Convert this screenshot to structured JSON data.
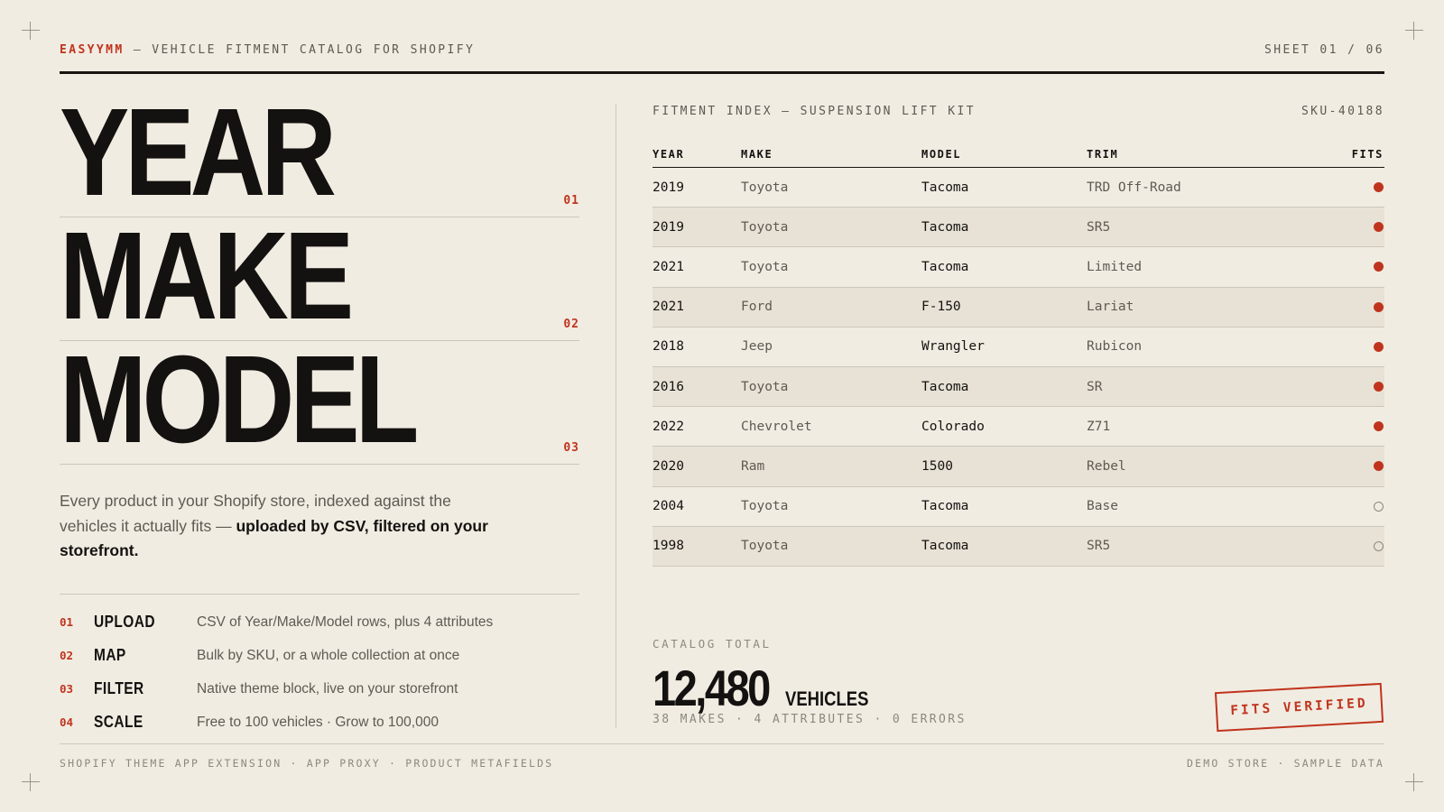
{
  "header": {
    "brand": "EASYYMM",
    "tagline": " — VEHICLE FITMENT CATALOG FOR SHOPIFY",
    "sheet": "SHEET 01 / 06"
  },
  "hero": [
    {
      "word": "YEAR",
      "num": "01"
    },
    {
      "word": "MAKE",
      "num": "02"
    },
    {
      "word": "MODEL",
      "num": "03"
    }
  ],
  "lede": {
    "text": "Every product in your Shopify store, indexed against the vehicles it actually fits — ",
    "emphasis": "uploaded by CSV, filtered on your storefront."
  },
  "steps": [
    {
      "num": "01",
      "title": "UPLOAD",
      "desc": "CSV of Year/Make/Model rows, plus 4 attributes"
    },
    {
      "num": "02",
      "title": "MAP",
      "desc": "Bulk by SKU, or a whole collection at once"
    },
    {
      "num": "03",
      "title": "FILTER",
      "desc": "Native theme block, live on your storefront"
    },
    {
      "num": "04",
      "title": "SCALE",
      "desc": "Free to 100 vehicles · Grow to 100,000"
    }
  ],
  "fitment": {
    "title": "FITMENT INDEX — SUSPENSION LIFT KIT",
    "sku": "SKU-40188",
    "columns": [
      "YEAR",
      "MAKE",
      "MODEL",
      "TRIM",
      "FITS"
    ],
    "rows": [
      {
        "year": "2019",
        "make": "Toyota",
        "model": "Tacoma",
        "trim": "TRD Off-Road",
        "fits": true
      },
      {
        "year": "2019",
        "make": "Toyota",
        "model": "Tacoma",
        "trim": "SR5",
        "fits": true
      },
      {
        "year": "2021",
        "make": "Toyota",
        "model": "Tacoma",
        "trim": "Limited",
        "fits": true
      },
      {
        "year": "2021",
        "make": "Ford",
        "model": "F-150",
        "trim": "Lariat",
        "fits": true
      },
      {
        "year": "2018",
        "make": "Jeep",
        "model": "Wrangler",
        "trim": "Rubicon",
        "fits": true
      },
      {
        "year": "2016",
        "make": "Toyota",
        "model": "Tacoma",
        "trim": "SR",
        "fits": true
      },
      {
        "year": "2022",
        "make": "Chevrolet",
        "model": "Colorado",
        "trim": "Z71",
        "fits": true
      },
      {
        "year": "2020",
        "make": "Ram",
        "model": "1500",
        "trim": "Rebel",
        "fits": true
      },
      {
        "year": "2004",
        "make": "Toyota",
        "model": "Tacoma",
        "trim": "Base",
        "fits": false
      },
      {
        "year": "1998",
        "make": "Toyota",
        "model": "Tacoma",
        "trim": "SR5",
        "fits": false
      }
    ]
  },
  "catalog": {
    "label": "CATALOG TOTAL",
    "total": "12,480",
    "unit": "VEHICLES",
    "meta": "38 MAKES · 4 ATTRIBUTES · 0 ERRORS"
  },
  "stamp": "FITS VERIFIED",
  "footer": {
    "left": "SHOPIFY THEME APP EXTENSION · APP PROXY · PRODUCT METAFIELDS",
    "right": "DEMO STORE · SAMPLE DATA"
  },
  "colors": {
    "background": "#f1ece2",
    "accent": "#c0341d",
    "ink": "#141210"
  }
}
